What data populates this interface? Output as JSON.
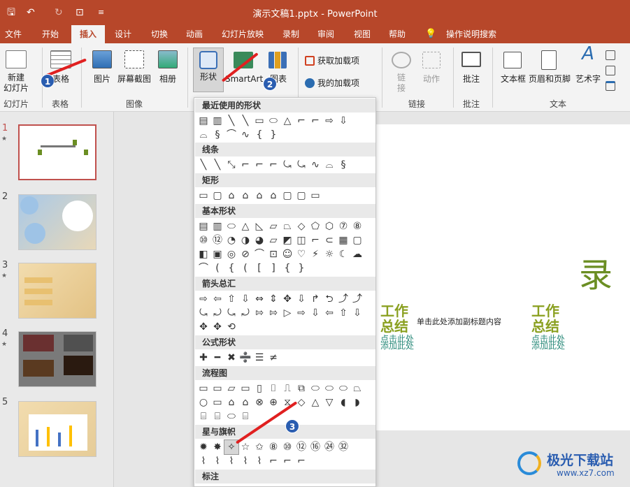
{
  "titlebar": {
    "title": "演示文稿1.pptx  -  PowerPoint",
    "save": "🖫",
    "undo": "↶",
    "redo": "↻",
    "present": "⊡",
    "more": "≡"
  },
  "tabs": [
    "文件",
    "开始",
    "插入",
    "设计",
    "切换",
    "动画",
    "幻灯片放映",
    "录制",
    "审阅",
    "视图",
    "帮助",
    "操作说明搜索"
  ],
  "ribbon": {
    "new_slide": "新建\n幻灯片",
    "table": "表格",
    "picture": "图片",
    "screenshot": "屏幕截图",
    "album": "相册",
    "shapes": "形状",
    "smartart": "SmartArt",
    "chart": "图表",
    "get_addins": "获取加载项",
    "my_addins": "我的加载项",
    "link": "链\n接",
    "action": "动作",
    "comment": "批注",
    "textbox": "文本框",
    "header_footer": "页眉和页脚",
    "wordart": "艺术字",
    "groups": [
      "幻灯片",
      "表格",
      "图像",
      "链接",
      "批注",
      "文本"
    ]
  },
  "shapes_menu": {
    "sections": [
      "最近使用的形状",
      "线条",
      "矩形",
      "基本形状",
      "箭头总汇",
      "公式形状",
      "流程图",
      "星与旗帜",
      "标注"
    ],
    "recent": [
      "▤",
      "▥",
      "╲",
      "╲",
      "▭",
      "⬭",
      "△",
      "⌐",
      "⌐",
      "⇨",
      "⇩",
      "⌓",
      "§",
      "⌒",
      "∿",
      "{",
      "}"
    ],
    "lines": [
      "╲",
      "╲",
      "⤡",
      "⌐",
      "⌐",
      "⌐",
      "⤿",
      "⤿",
      "∿",
      "⌓",
      "§"
    ],
    "rects": [
      "▭",
      "▢",
      "⌂",
      "⌂",
      "⌂",
      "⌂",
      "▢",
      "▢",
      "▭"
    ],
    "basic1": [
      "▤",
      "▥",
      "⬭",
      "△",
      "◺",
      "▱",
      "⏢",
      "◇",
      "⬠",
      "⬡",
      "⑦",
      "⑧"
    ],
    "basic2": [
      "⑩",
      "⑫",
      "◔",
      "◑",
      "◕",
      "▱",
      "◩",
      "◫",
      "⌐",
      "⊂",
      "▦",
      "▢"
    ],
    "basic3": [
      "◧",
      "▣",
      "◎",
      "⊘",
      "⌒",
      "⊡",
      "☺",
      "♡",
      "⚡",
      "☼",
      "☾",
      "☁"
    ],
    "basic4": [
      "⌒",
      "(",
      "{",
      "(",
      "[",
      "]",
      "{",
      "}"
    ],
    "arrows1": [
      "⇨",
      "⇦",
      "⇧",
      "⇩",
      "⇔",
      "⇕",
      "✥",
      "⇩",
      "↱",
      "⮌",
      "⤴",
      "⤴"
    ],
    "arrows2": [
      "⤿",
      "⤾",
      "⤿",
      "⤾",
      "⇰",
      "⇰",
      "▷",
      "⇨",
      "⇩",
      "⇦",
      "⇧",
      "⇩"
    ],
    "arrows3": [
      "✥",
      "✥",
      "⟲"
    ],
    "equation": [
      "✚",
      "━",
      "✖",
      "➗",
      "☰",
      "≠"
    ],
    "flow1": [
      "▭",
      "▭",
      "▱",
      "▭",
      "▯",
      "⌷",
      "⎍",
      "⧉",
      "⬭",
      "⬭",
      "⬭",
      "⏢"
    ],
    "flow2": [
      "○",
      "▭",
      "⌂",
      "⌂",
      "⊗",
      "⊕",
      "⧖",
      "◇",
      "△",
      "▽",
      "◖",
      "◗"
    ],
    "flow3": [
      "⌸",
      "⌸",
      "⬭",
      "⌸"
    ],
    "stars1": [
      "✹",
      "✸",
      "✧",
      "☆",
      "✩",
      "⑧",
      "⑩",
      "⑫",
      "⑯",
      "㉔",
      "㉜"
    ],
    "stars2": [
      "⌇",
      "⌇",
      "⌇",
      "⌇",
      "⌇",
      "⌐",
      "⌐",
      "⌐"
    ]
  },
  "slides": [
    "1",
    "2",
    "3",
    "4",
    "5"
  ],
  "canvas": {
    "big_char": "录",
    "wgzj1": "工作\n总结",
    "sub1": "点击此处\n添加此处",
    "title_text": "单击此处添加副标题内容",
    "wgzj2": "工作\n总结",
    "sub2": "点击此处\n添加此处"
  },
  "badges": [
    "1",
    "2",
    "3"
  ],
  "watermark": {
    "brand": "极光下载站",
    "url": "www.xz7.com"
  }
}
